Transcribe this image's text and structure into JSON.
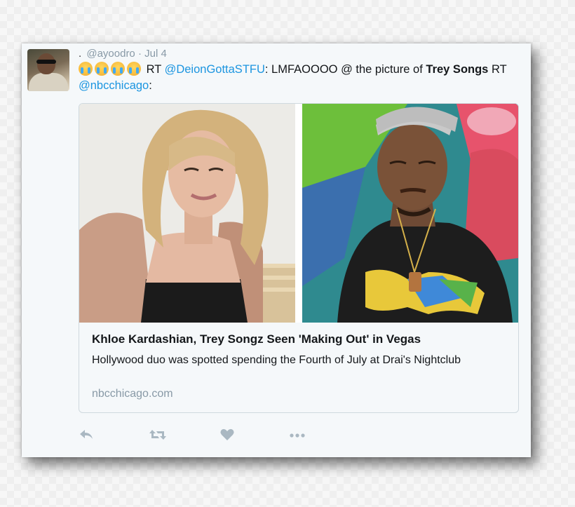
{
  "tweet": {
    "display_name": ".",
    "handle": "@ayoodro",
    "date": "Jul 4",
    "separator": "·",
    "text": {
      "rt1": "RT",
      "mention1": "@DeionGottaSTFU",
      "body": ": LMFAOOOO @ the picture of",
      "bold": "Trey Songs",
      "rt2": "RT",
      "mention2": "@nbcchicago",
      "end": ":"
    },
    "emoji_count": 4
  },
  "card": {
    "title": "Khloe Kardashian, Trey Songz Seen 'Making Out' in Vegas",
    "description": "Hollywood duo was spotted spending the Fourth of July at Drai's Nightclub",
    "domain": "nbcchicago.com"
  },
  "actions": {
    "reply_icon": "reply-icon",
    "retweet_icon": "retweet-icon",
    "like_icon": "heart-icon",
    "more_icon": "more-icon"
  },
  "colors": {
    "link": "#1b95e0",
    "muted": "#8899a6",
    "icon": "#aab8c2"
  }
}
